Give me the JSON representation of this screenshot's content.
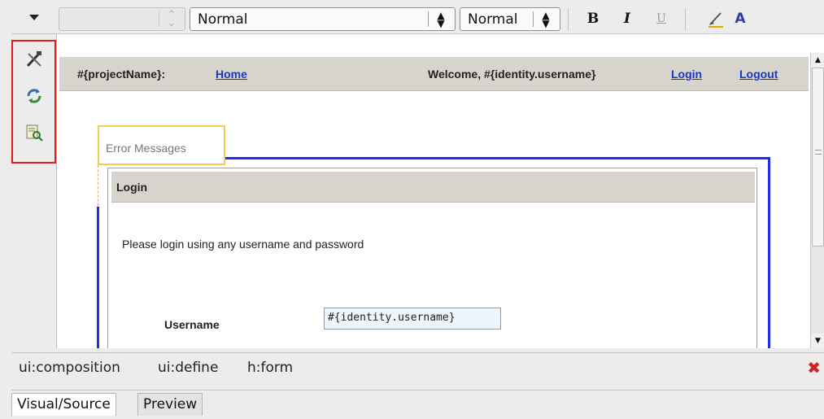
{
  "toolbar": {
    "format_left": "Normal",
    "format_right": "Normal",
    "bold_label": "B",
    "italic_label": "I",
    "underline_label": "U",
    "brush_icon": "brush-icon",
    "font_color_label": "A"
  },
  "palette": {
    "icons": [
      "tools-icon",
      "refresh-icon",
      "preview-icon"
    ]
  },
  "page": {
    "project_name": "#{projectName}:",
    "home_link": "Home",
    "welcome": "Welcome, #{identity.username}",
    "login_link": "Login",
    "logout_link": "Logout",
    "error_messages": "Error Messages",
    "panel_title": "Login",
    "panel_message": "Please login using any username and password",
    "username_label": "Username",
    "username_value": "#{identity.username}"
  },
  "pathbar": {
    "items": [
      "ui:composition",
      "ui:define",
      "h:form"
    ]
  },
  "tabs": [
    "Visual/Source",
    "Preview"
  ],
  "colors": {
    "highlight_red": "#e01c1c",
    "link_blue": "#1b36c7",
    "selection_blue": "#1f2ee6",
    "error_box_yellow": "#f2cc55",
    "close_red": "#d62020"
  }
}
